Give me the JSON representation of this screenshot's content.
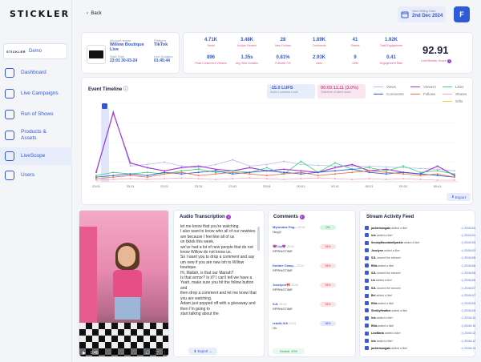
{
  "app": {
    "logo": "STICKLER"
  },
  "workspace": {
    "mini_logo": "STICKLER",
    "name": "Demo"
  },
  "nav": [
    {
      "label": "Dashboard",
      "icon": "dashboard-icon"
    },
    {
      "label": "Live Campaigns",
      "icon": "campaign-icon"
    },
    {
      "label": "Run of Shows",
      "icon": "calendar-icon"
    },
    {
      "label": "Products & Assets",
      "icon": "products-icon"
    },
    {
      "label": "LiveScope",
      "icon": "livescope-icon",
      "active": true
    },
    {
      "label": "Users",
      "icon": "users-icon"
    }
  ],
  "topbar": {
    "back": "Back",
    "date_label": "Next Billing Date",
    "date_value": "2nd Dec 2024",
    "avatar": "F"
  },
  "account": {
    "name_label": "Account Name",
    "name": "Willow Boutique Live",
    "platform_label": "Platform",
    "platform": "TikTok",
    "start_label": "Start Time",
    "start": "23:01 30-03-24",
    "duration_label": "Live Duration",
    "duration": "01:45:44"
  },
  "metrics": [
    {
      "value": "4.71K",
      "label": "Views"
    },
    {
      "value": "3.48K",
      "label": "Unique Viewers"
    },
    {
      "value": "28",
      "label": "New Follows"
    },
    {
      "value": "1.89K",
      "label": "Comments"
    },
    {
      "value": "41",
      "label": "Shares"
    },
    {
      "value": "1.92K",
      "label": "Total Engagement"
    },
    {
      "value": "896",
      "label": "Peak Concurrent Viewers"
    },
    {
      "value": "1.35s",
      "label": "Avg View Duration"
    },
    {
      "value": "0.81%",
      "label": "Follower CR"
    },
    {
      "value": "2.93K",
      "label": "Likes"
    },
    {
      "value": "9",
      "label": "Gifts"
    },
    {
      "value": "0.41",
      "label": "Engagement Rate"
    }
  ],
  "score": {
    "value": "92.91",
    "label": "LiveStream Score"
  },
  "timeline": {
    "title": "Event Timeline",
    "lufs": "-15.0 LUFS",
    "lufs_sub": "Audio Loudness Level",
    "time": "00:03:11.11 (3.0%)",
    "time_sub": "Total time of silent audio",
    "export": "Export",
    "legend": [
      "Views",
      "Viewers",
      "Likes",
      "Comments",
      "Follows",
      "Shares",
      "Gifts"
    ],
    "ticks": [
      "23:01",
      "23:11",
      "23:21",
      "23:31",
      "23:41",
      "23:51",
      "00:01",
      "00:11",
      "00:21",
      "00:31",
      "00:41"
    ]
  },
  "chart_data": {
    "type": "line",
    "title": "Event Timeline",
    "x": [
      "23:01",
      "23:06",
      "23:11",
      "23:16",
      "23:21",
      "23:26",
      "23:31",
      "23:36",
      "23:41",
      "23:46",
      "23:51",
      "23:56",
      "00:01",
      "00:06",
      "00:11",
      "00:16",
      "00:21",
      "00:26",
      "00:31",
      "00:36",
      "00:41",
      "00:46"
    ],
    "series": [
      {
        "name": "Views",
        "color": "#b9bde6",
        "values": [
          14,
          90,
          20,
          22,
          25,
          20,
          18,
          22,
          28,
          20,
          22,
          26,
          22,
          21,
          20,
          20,
          20,
          19,
          18,
          17,
          16,
          14
        ]
      },
      {
        "name": "Viewers",
        "color": "#a43bd6",
        "values": [
          12,
          88,
          24,
          18,
          14,
          18,
          20,
          16,
          14,
          18,
          14,
          16,
          14,
          12,
          18,
          22,
          14,
          16,
          12,
          10,
          20,
          8
        ]
      },
      {
        "name": "Likes",
        "color": "#3ad17e",
        "values": [
          8,
          12,
          10,
          12,
          10,
          14,
          16,
          12,
          14,
          12,
          18,
          10,
          26,
          12,
          24,
          16,
          18,
          14,
          20,
          12,
          14,
          10
        ]
      },
      {
        "name": "Comments",
        "color": "#3457d5",
        "values": [
          6,
          8,
          10,
          8,
          12,
          10,
          12,
          14,
          10,
          12,
          14,
          12,
          10,
          12,
          14,
          16,
          12,
          10,
          12,
          10,
          8,
          6
        ]
      },
      {
        "name": "Follows",
        "color": "#e8734a",
        "values": [
          4,
          6,
          8,
          6,
          10,
          12,
          8,
          10,
          12,
          10,
          8,
          10,
          12,
          8,
          10,
          12,
          14,
          12,
          10,
          8,
          10,
          6
        ]
      },
      {
        "name": "Shares",
        "color": "#f2a6c6",
        "values": [
          2,
          3,
          4,
          3,
          4,
          5,
          4,
          3,
          4,
          5,
          4,
          3,
          4,
          5,
          4,
          3,
          4,
          3,
          4,
          3,
          2,
          2
        ]
      }
    ],
    "ylim": [
      0,
      100
    ]
  },
  "video": {
    "time": "0:40",
    "export": "Export"
  },
  "transcript": {
    "title": "Audio Transcription",
    "lines": [
      "let me know that you're watching.",
      "I also want to know who all of our newbies are because I feel like all of us",
      "on tiktok this week,",
      "we've had a lot of new people that do not know Willow do not know us.",
      "So I want you to drop a comment and say",
      "um new if you are new ish to Willow boutique.",
      "Hi, Mallah, is that our Mariah?",
      "Is that armor? Is it? I can't tell we have a",
      "Yeah, make sure you hit the follow button and",
      "then drop a comment and let me know that you are watching.",
      "Adam just popped off with a giveaway and then I'm going to",
      "start talking about the"
    ]
  },
  "comments": {
    "title": "Comments",
    "items": [
      {
        "name": "Myrandas Pag...",
        "time": "23:04",
        "score": "0%",
        "msg": "Heyy!!",
        "badge_color": "#d6f5e3",
        "badge_text": "#1f9d55"
      },
      {
        "name": "💜Lily💜",
        "time": "23:04",
        "score": "34%",
        "msg": "SPRINGTIME",
        "badge_color": "#fde2e2",
        "badge_text": "#d43c3c"
      },
      {
        "name": "Dobbie Camp...",
        "time": "23:04",
        "score": "34%",
        "msg": "SPRINGTIME",
        "badge_color": "#fde2e2",
        "badge_text": "#d43c3c"
      },
      {
        "name": "Joszlynn🎀",
        "time": "23:04",
        "score": "34%",
        "msg": "SPRINGTIME",
        "badge_color": "#fde2e2",
        "badge_text": "#d43c3c"
      },
      {
        "name": "SJL",
        "time": "23:04",
        "score": "34%",
        "msg": "SPRINGTIME",
        "badge_color": "#fde2e2",
        "badge_text": "#d43c3c"
      },
      {
        "name": "reddit-316",
        "time": "23:04",
        "score": "98%",
        "msg": "Oh",
        "badge_color": "#e3e9fb",
        "badge_text": "#3457d5"
      }
    ],
    "neutral": "Neutral: 40%"
  },
  "feed": {
    "title": "Stream Activity Feed",
    "items": [
      {
        "user": "jacklemungalo",
        "action": "added a like!",
        "time": "23:04:00"
      },
      {
        "user": "leis",
        "action": "added a like!",
        "time": "23:04:01"
      },
      {
        "user": "SmokyMountainSparkle",
        "action": "added a like!",
        "time": "23:04:03"
      },
      {
        "user": "Joszlynn",
        "action": "added a like!",
        "time": "23:04:03"
      },
      {
        "user": "SJL",
        "action": "shared the stream!",
        "time": "23:04:05"
      },
      {
        "user": "Rilla",
        "action": "added a like!",
        "time": "23:04:06"
      },
      {
        "user": "SJL",
        "action": "shared the stream!",
        "time": "23:04:06"
      },
      {
        "user": "Lis",
        "action": "added a like!",
        "time": "23:04:06"
      },
      {
        "user": "SJL",
        "action": "shared the stream!",
        "time": "23:04:07"
      },
      {
        "user": "Bel",
        "action": "added a like!",
        "time": "23:04:07"
      },
      {
        "user": "Rilla",
        "action": "added a like!",
        "time": "23:04:09"
      },
      {
        "user": "ShelbyHeather",
        "action": "added a like!",
        "time": "23:04:09"
      },
      {
        "user": "leis",
        "action": "added a like!",
        "time": "23:04:10"
      },
      {
        "user": "Rilla",
        "action": "added a like!",
        "time": "23:04:10"
      },
      {
        "user": "LizzMaria",
        "action": "added a like!",
        "time": "23:04:12"
      },
      {
        "user": "leis",
        "action": "added a like!",
        "time": "23:04:12"
      },
      {
        "user": "jacklemungalo",
        "action": "added a like!",
        "time": "23:04:13"
      }
    ]
  },
  "colors": {
    "accent": "#3457d5",
    "pink": "#e0508e",
    "purple": "#a43bd6"
  }
}
